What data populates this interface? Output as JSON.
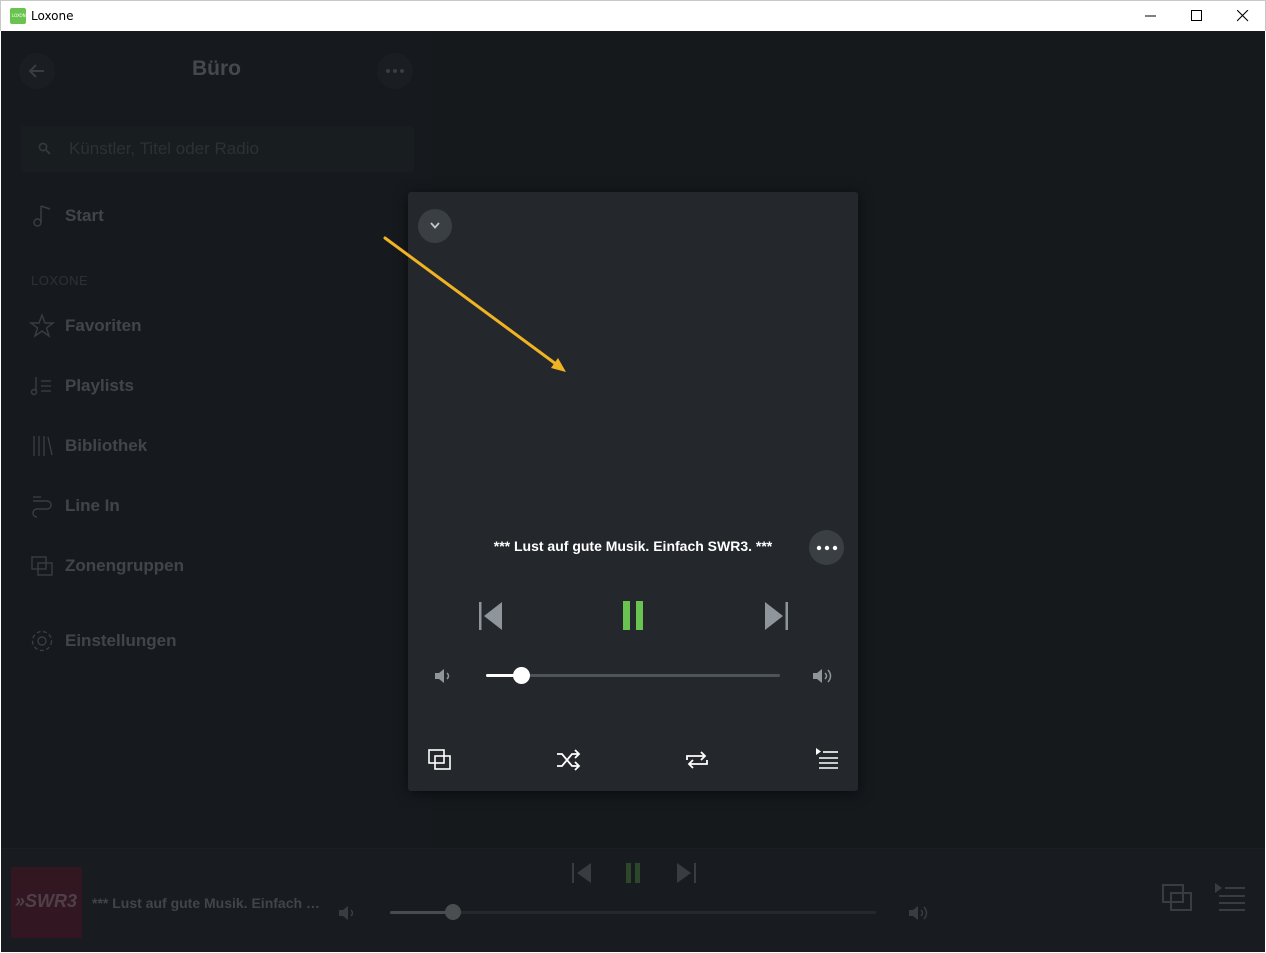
{
  "window": {
    "title": "Loxone",
    "logo_text": "LOXONE"
  },
  "sidebar": {
    "zone_title": "Büro",
    "search_placeholder": "Künstler, Titel oder Radio",
    "start_label": "Start",
    "section_label": "LOXONE",
    "items": [
      {
        "label": "Favoriten",
        "icon": "star-icon"
      },
      {
        "label": "Playlists",
        "icon": "playlist-icon"
      },
      {
        "label": "Bibliothek",
        "icon": "library-icon"
      },
      {
        "label": "Line In",
        "icon": "line-in-icon"
      },
      {
        "label": "Zonengruppen",
        "icon": "zone-groups-icon"
      }
    ],
    "settings_label": "Einstellungen"
  },
  "player_popup": {
    "track_title": "*** Lust auf gute Musik. Einfach SWR3. ***",
    "state": "playing",
    "volume": 0.12
  },
  "bottom_bar": {
    "cover_text": "»SWR3",
    "track_title": "*** Lust auf gute Musik. Einfach SWR3. ***",
    "volume": 0.13
  },
  "colors": {
    "background": "#1a1e21",
    "popup": "#24282c",
    "accent_green": "#69c350",
    "annotation_arrow": "#f0b323"
  }
}
